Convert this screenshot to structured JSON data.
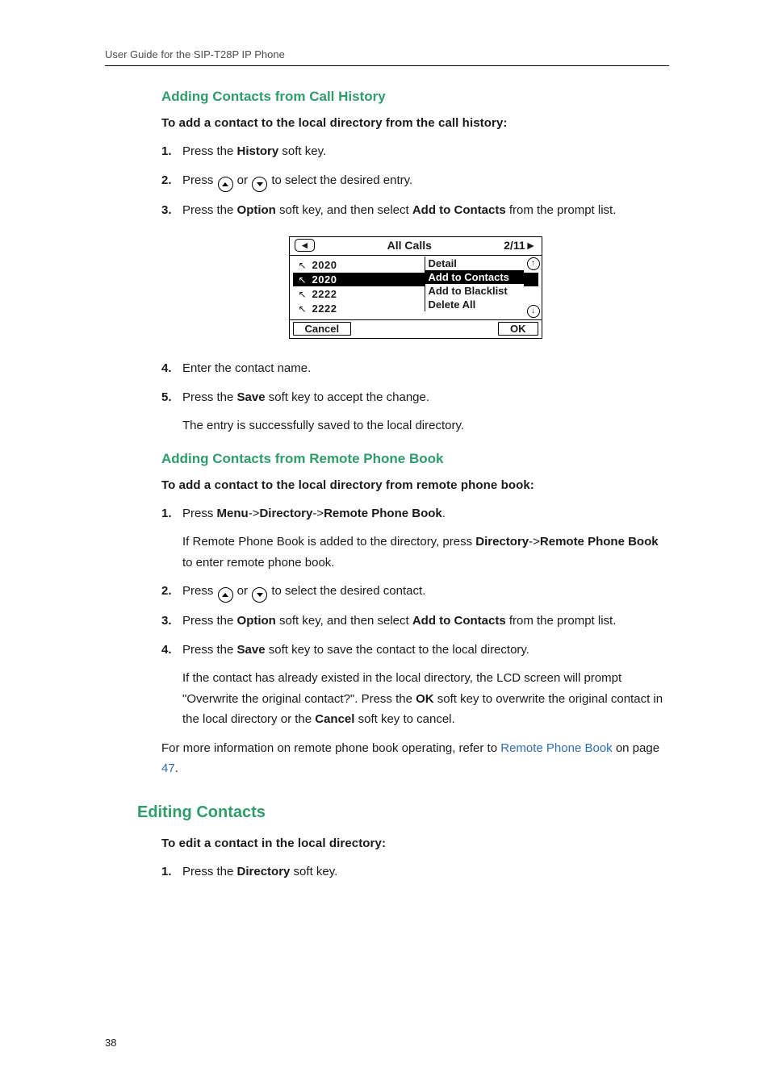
{
  "header": {
    "runner": "User Guide for the SIP-T28P IP Phone"
  },
  "page_number": "38",
  "s1": {
    "title": "Adding Contacts from Call History",
    "lead": "To add a contact to the local directory from the call history:",
    "step1_pre": "Press the ",
    "step1_b": "History",
    "step1_post": " soft key.",
    "step2_pre": "Press ",
    "step2_or": " or ",
    "step2_post": " to select the desired entry.",
    "step3_pre": "Press the ",
    "step3_b1": "Option",
    "step3_mid": " soft key, and then select ",
    "step3_b2": "Add to Contacts",
    "step3_post": " from the prompt list.",
    "step4": "Enter the contact name.",
    "step5_pre": "Press the ",
    "step5_b": "Save",
    "step5_post": " soft key to accept the change.",
    "step5_after": "The entry is successfully saved to the local directory."
  },
  "lcd": {
    "title": "All Calls",
    "page": "2/11",
    "rows": [
      {
        "num": "2020"
      },
      {
        "num": "2020"
      },
      {
        "num": "2222"
      },
      {
        "num": "2222"
      }
    ],
    "selected_row_index": 1,
    "menu": [
      "Detail",
      "Add to Contacts",
      "Add to Blacklist",
      "Delete All"
    ],
    "selected_menu_index": 1,
    "soft_left": "Cancel",
    "soft_right": "OK"
  },
  "s2": {
    "title": "Adding Contacts from Remote Phone Book",
    "lead": "To add a contact to the local directory from remote phone book:",
    "step1_pre": "Press ",
    "step1_b1": "Menu",
    "step1_arr1": "->",
    "step1_b2": "Directory",
    "step1_arr2": "->",
    "step1_b3": "Remote Phone Book",
    "step1_period": ".",
    "step1_after_pre": "If Remote Phone Book is added to the directory, press ",
    "step1_after_b1": "Directory",
    "step1_after_mid": "->",
    "step1_after_b2": "Remote Phone Book",
    "step1_after_post": " to enter remote phone book.",
    "step2_pre": "Press ",
    "step2_or": " or ",
    "step2_post": " to select the desired contact.",
    "step3_pre": "Press the ",
    "step3_b1": "Option",
    "step3_mid": " soft key, and then select ",
    "step3_b2": "Add to Contacts",
    "step3_post": " from the prompt list.",
    "step4_pre": "Press the ",
    "step4_b": "Save",
    "step4_post": " soft key to save the contact to the local directory.",
    "step4_after_pre": "If the contact has already existed in the local directory, the LCD screen will prompt \"Overwrite the original contact?\". Press the ",
    "step4_after_b1": "OK",
    "step4_after_mid": " soft key to overwrite the original contact in the local directory or the ",
    "step4_after_b2": "Cancel",
    "step4_after_post": " soft key to cancel.",
    "ref_pre": "For more information on remote phone book operating, refer to ",
    "ref_link": "Remote Phone Book",
    "ref_mid": " on page ",
    "ref_page": "47",
    "ref_post": "."
  },
  "s3": {
    "title": "Editing Contacts",
    "lead": "To edit a contact in the local directory:",
    "step1_pre": "Press the ",
    "step1_b": "Directory",
    "step1_post": " soft key."
  }
}
